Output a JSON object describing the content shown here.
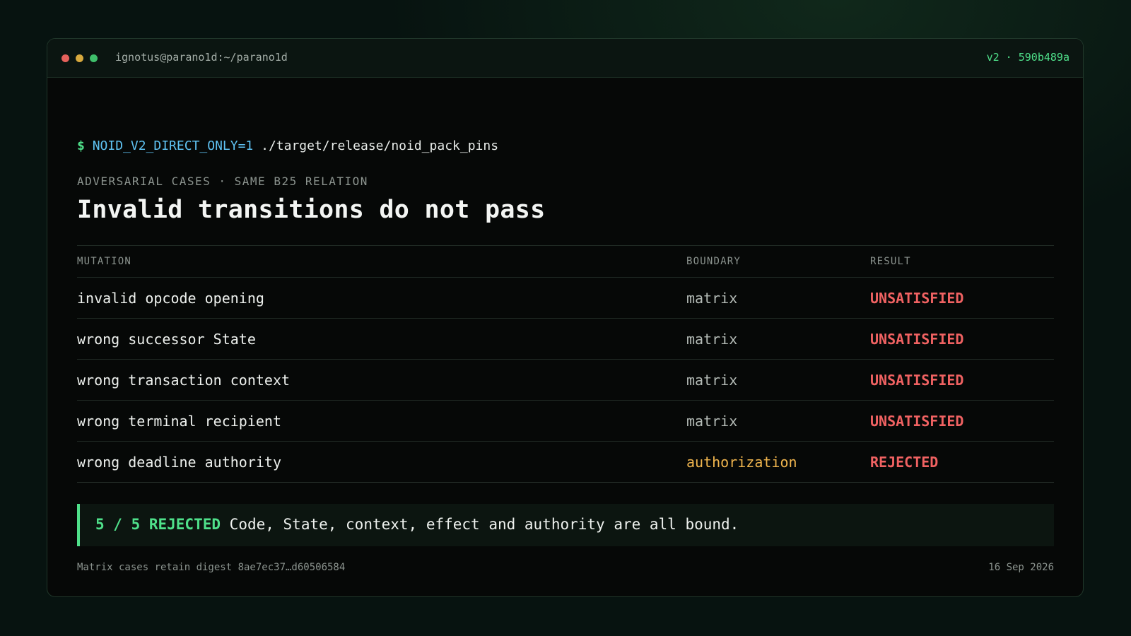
{
  "window": {
    "title": "ignotus@parano1d:~/parano1d",
    "version_tag": "v2 · 590b489a",
    "controls": [
      "close",
      "minimize",
      "maximize"
    ]
  },
  "command": {
    "prompt": "$",
    "env": "NOID_V2_DIRECT_ONLY=1",
    "path": "./target/release/noid_pack_pins"
  },
  "eyebrow": "ADVERSARIAL CASES · SAME B25 RELATION",
  "headline": "Invalid transitions do not pass",
  "table": {
    "headers": {
      "mutation": "MUTATION",
      "boundary": "BOUNDARY",
      "result": "RESULT"
    },
    "rows": [
      {
        "mutation": "invalid opcode opening",
        "boundary": "matrix",
        "result": "UNSATISFIED"
      },
      {
        "mutation": "wrong successor State",
        "boundary": "matrix",
        "result": "UNSATISFIED"
      },
      {
        "mutation": "wrong transaction context",
        "boundary": "matrix",
        "result": "UNSATISFIED"
      },
      {
        "mutation": "wrong terminal recipient",
        "boundary": "matrix",
        "result": "UNSATISFIED"
      },
      {
        "mutation": "wrong deadline authority",
        "boundary": "authorization",
        "result": "REJECTED"
      }
    ]
  },
  "summary": {
    "count": "5 / 5 REJECTED",
    "text": "Code, State, context, effect and authority are all bound."
  },
  "footer": {
    "note": "Matrix cases retain digest 8ae7ec37…d60506584",
    "date": "16 Sep 2026"
  },
  "colors": {
    "accent_green": "#4fe08a",
    "error_red": "#f06262",
    "warning_amber": "#f0b54e",
    "env_blue": "#5fc2f2"
  }
}
